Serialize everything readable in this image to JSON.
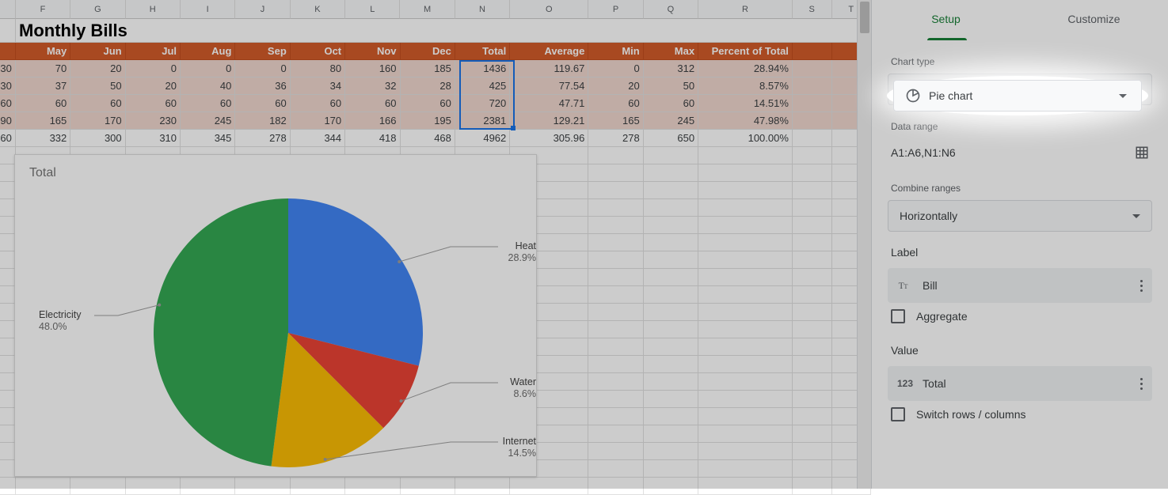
{
  "page_title": "Monthly Bills",
  "columns": [
    "F",
    "G",
    "H",
    "I",
    "J",
    "K",
    "L",
    "M",
    "N",
    "O",
    "P",
    "Q",
    "R",
    "S",
    "T"
  ],
  "header_row": [
    "May",
    "Jun",
    "Jul",
    "Aug",
    "Sep",
    "Oct",
    "Nov",
    "Dec",
    "Total",
    "Average",
    "Min",
    "Max",
    "Percent of Total"
  ],
  "data_rows": [
    {
      "edge": "30",
      "cells": [
        "70",
        "20",
        "0",
        "0",
        "0",
        "80",
        "160",
        "185",
        "1436",
        "119.67",
        "0",
        "312",
        "28.94%"
      ]
    },
    {
      "edge": "30",
      "cells": [
        "37",
        "50",
        "20",
        "40",
        "36",
        "34",
        "32",
        "28",
        "425",
        "77.54",
        "20",
        "50",
        "8.57%"
      ]
    },
    {
      "edge": "60",
      "cells": [
        "60",
        "60",
        "60",
        "60",
        "60",
        "60",
        "60",
        "60",
        "720",
        "47.71",
        "60",
        "60",
        "14.51%"
      ]
    },
    {
      "edge": "90",
      "cells": [
        "165",
        "170",
        "230",
        "245",
        "182",
        "170",
        "166",
        "195",
        "2381",
        "129.21",
        "165",
        "245",
        "47.98%"
      ]
    },
    {
      "edge": "60",
      "cells": [
        "332",
        "300",
        "310",
        "345",
        "278",
        "344",
        "418",
        "468",
        "4962",
        "305.96",
        "278",
        "650",
        "100.00%"
      ]
    }
  ],
  "chart_data": {
    "type": "pie",
    "title": "Total",
    "series": [
      {
        "name": "Heat",
        "value": 1436,
        "percent": 28.9,
        "color": "#4285F4"
      },
      {
        "name": "Water",
        "value": 425,
        "percent": 8.6,
        "color": "#EA4335"
      },
      {
        "name": "Internet",
        "value": 720,
        "percent": 14.5,
        "color": "#FBBC04"
      },
      {
        "name": "Electricity",
        "value": 2381,
        "percent": 48.0,
        "color": "#34A853"
      }
    ]
  },
  "panel": {
    "tabs": {
      "setup": "Setup",
      "customize": "Customize"
    },
    "chart_type_label": "Chart type",
    "chart_type_value": "Pie chart",
    "data_range_label": "Data range",
    "data_range_value": "A1:A6,N1:N6",
    "combine_label": "Combine ranges",
    "combine_value": "Horizontally",
    "label_section": "Label",
    "label_chip": "Bill",
    "aggregate": "Aggregate",
    "value_section": "Value",
    "value_chip": "Total",
    "switch": "Switch rows / columns"
  }
}
